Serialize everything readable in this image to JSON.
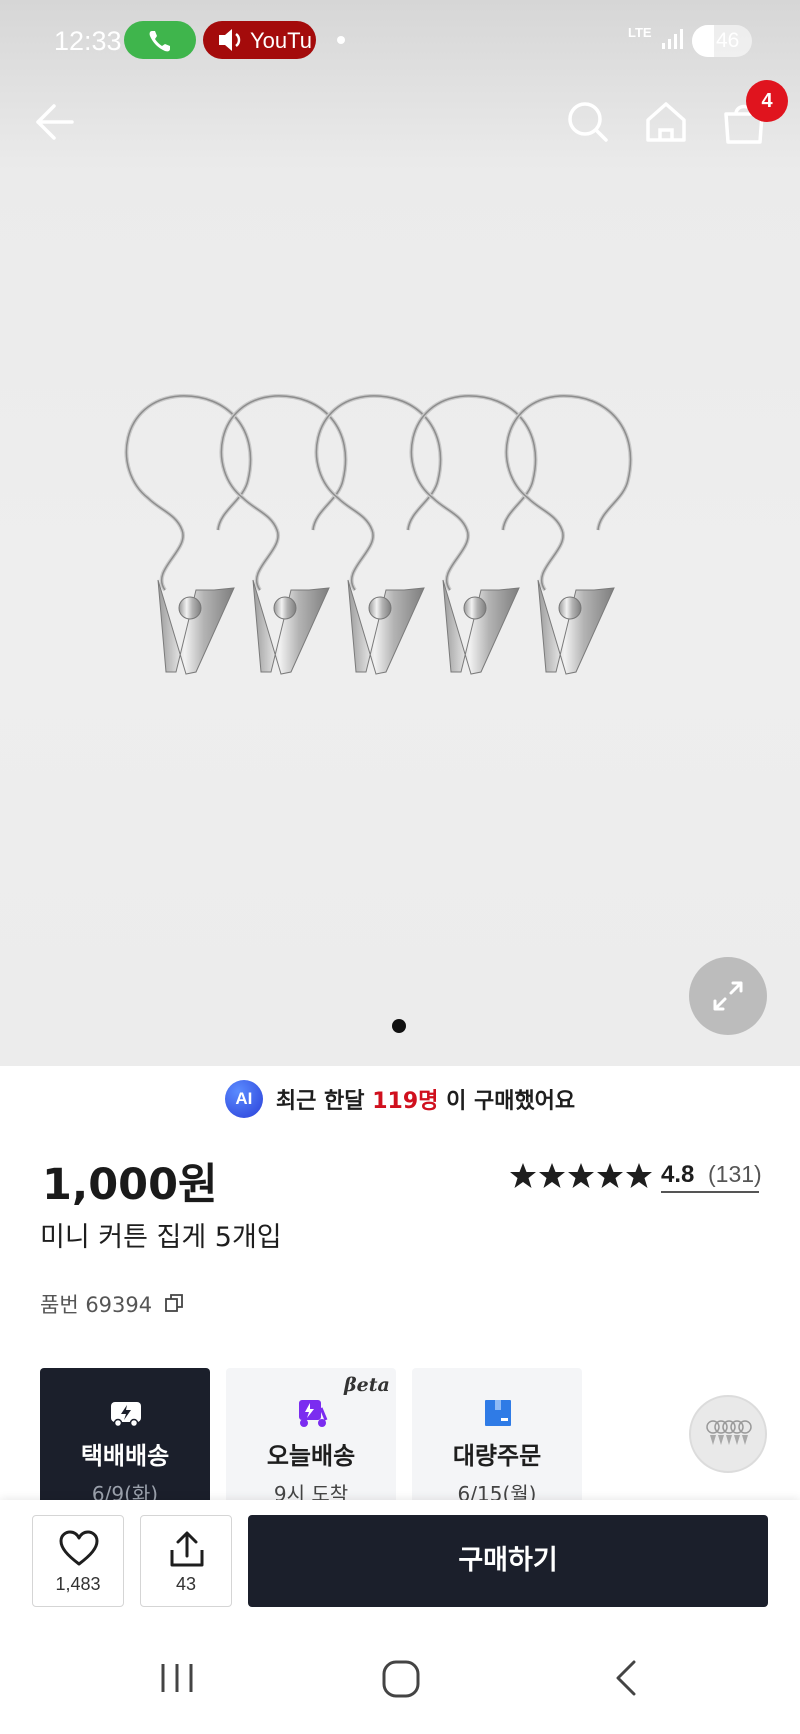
{
  "status_bar": {
    "time": "12:33",
    "youtube_label": "YouTu",
    "network": "LTE",
    "battery": "46"
  },
  "cart_badge": "4",
  "gallery": {
    "page_count": 1,
    "current_page": 1
  },
  "purchase_note": {
    "ai_label": "AI",
    "prefix": "최근 한달",
    "count": "119명",
    "suffix": "이 구매했어요"
  },
  "product": {
    "price": "1,000원",
    "rating_value": "4.8",
    "rating_stars": 4.8,
    "review_count": "(131)",
    "title": "미니 커튼 집게 5개입",
    "sku": "품번 69394"
  },
  "delivery_options": [
    {
      "label": "택배배송",
      "date": "6/9(화)",
      "selected": true
    },
    {
      "label": "오늘배송",
      "date": "9시 도착",
      "badge": "βeta",
      "selected": false
    },
    {
      "label": "대량주문",
      "date": "6/15(월)",
      "selected": false
    }
  ],
  "actions": {
    "like_count": "1,483",
    "share_count": "43",
    "buy_label": "구매하기"
  },
  "colors": {
    "brand_dark": "#1b1f2b",
    "accent_red": "#d0101e",
    "badge_red": "#e0141e",
    "call_green": "#3fb54c",
    "youtube_red": "#a40b0b"
  }
}
